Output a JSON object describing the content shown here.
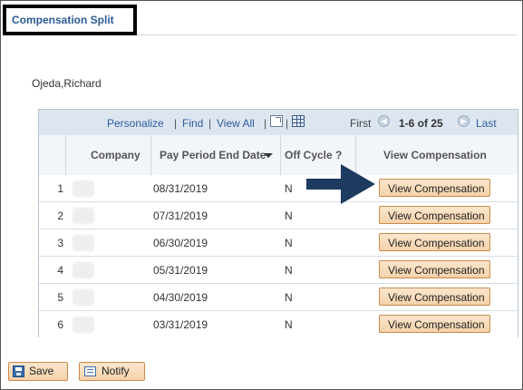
{
  "page": {
    "title": "Compensation Split",
    "employee_name": "Ojeda,Richard"
  },
  "grid": {
    "toolbar": {
      "personalize": "Personalize",
      "find": "Find",
      "view_all": "View All",
      "separator": "|",
      "first": "First",
      "range": "1-6 of 25",
      "last": "Last"
    },
    "columns": {
      "company": "Company",
      "pay_period_end_date": "Pay Period End Date",
      "off_cycle": "Off Cycle ?",
      "view_compensation": "View Compensation"
    },
    "rows": [
      {
        "num": "1",
        "date": "08/31/2019",
        "off_cycle": "N",
        "button": "View Compensation"
      },
      {
        "num": "2",
        "date": "07/31/2019",
        "off_cycle": "N",
        "button": "View Compensation"
      },
      {
        "num": "3",
        "date": "06/30/2019",
        "off_cycle": "N",
        "button": "View Compensation"
      },
      {
        "num": "4",
        "date": "05/31/2019",
        "off_cycle": "N",
        "button": "View Compensation"
      },
      {
        "num": "5",
        "date": "04/30/2019",
        "off_cycle": "N",
        "button": "View Compensation"
      },
      {
        "num": "6",
        "date": "03/31/2019",
        "off_cycle": "N",
        "button": "View Compensation"
      }
    ]
  },
  "toolbar": {
    "save_label": "Save",
    "notify_label": "Notify"
  },
  "colors": {
    "accent": "#2d5c9e",
    "button_bg": "#f6d2aa",
    "arrow": "#1e3a5f"
  },
  "icons": {
    "prev": "chevron-left-circle-icon",
    "next": "chevron-right-circle-icon",
    "zoom": "new-window-icon",
    "download": "spreadsheet-icon",
    "sort": "sort-descending-icon",
    "annotation": "arrow-right-icon"
  }
}
